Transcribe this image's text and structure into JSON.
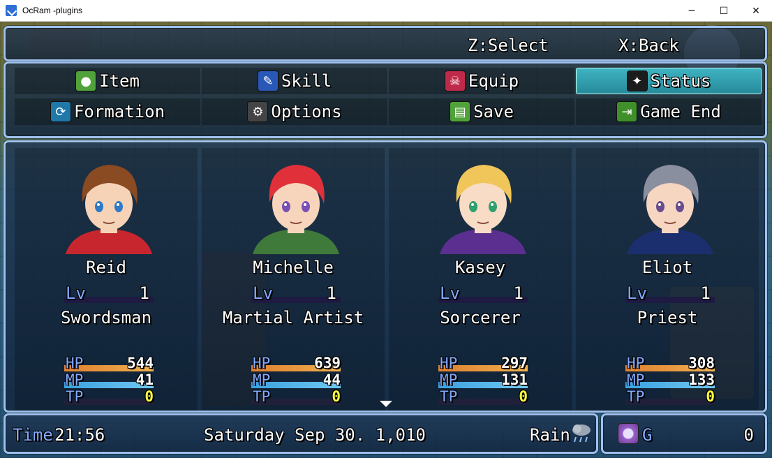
{
  "window": {
    "title": "OcRam -plugins",
    "controls": {
      "minimize": "─",
      "maximize": "☐",
      "close": "✕"
    }
  },
  "help": {
    "select": "Z:Select",
    "back": "X:Back"
  },
  "commands": [
    {
      "label": "Item",
      "icon": "bag-icon",
      "color": "#4fa33a",
      "glyph": "●",
      "selected": false
    },
    {
      "label": "Skill",
      "icon": "wand-icon",
      "color": "#2a58b8",
      "glyph": "✎",
      "selected": false
    },
    {
      "label": "Equip",
      "icon": "skull-icon",
      "color": "#c02a4a",
      "glyph": "☠",
      "selected": false
    },
    {
      "label": "Status",
      "icon": "boot-icon",
      "color": "#1c1c1c",
      "glyph": "✦",
      "selected": true
    },
    {
      "label": "Formation",
      "icon": "refresh-icon",
      "color": "#1f78a8",
      "glyph": "⟳",
      "selected": false
    },
    {
      "label": "Options",
      "icon": "gear-icon",
      "color": "#444444",
      "glyph": "⚙",
      "selected": false
    },
    {
      "label": "Save",
      "icon": "book-icon",
      "color": "#4fa33a",
      "glyph": "▤",
      "selected": false
    },
    {
      "label": "Game End",
      "icon": "exit-door-icon",
      "color": "#3f8f2a",
      "glyph": "⇥",
      "selected": false
    }
  ],
  "party": [
    {
      "name": "Reid",
      "class": "Swordsman",
      "level": "1",
      "hp": "544",
      "mp": "41",
      "tp": "0",
      "hp_ratio": 1,
      "mp_ratio": 1,
      "tp_ratio": 0,
      "portrait": {
        "hair": "#8a4a22",
        "skin": "#f6d3b6",
        "cloth": "#c8262e",
        "eyes": "#2f79c7"
      }
    },
    {
      "name": "Michelle",
      "class": "Martial Artist",
      "level": "1",
      "hp": "639",
      "mp": "44",
      "tp": "0",
      "hp_ratio": 1,
      "mp_ratio": 1,
      "tp_ratio": 0,
      "portrait": {
        "hair": "#e0303a",
        "skin": "#f7d5bd",
        "cloth": "#3f7a3a",
        "eyes": "#7a4fb5"
      }
    },
    {
      "name": "Kasey",
      "class": "Sorcerer",
      "level": "1",
      "hp": "297",
      "mp": "131",
      "tp": "0",
      "hp_ratio": 1,
      "mp_ratio": 1,
      "tp_ratio": 0,
      "portrait": {
        "hair": "#f0c65a",
        "skin": "#f8dcc6",
        "cloth": "#5a2f8f",
        "eyes": "#2fa06e"
      }
    },
    {
      "name": "Eliot",
      "class": "Priest",
      "level": "1",
      "hp": "308",
      "mp": "133",
      "tp": "0",
      "hp_ratio": 1,
      "mp_ratio": 1,
      "tp_ratio": 0,
      "portrait": {
        "hair": "#8a8f9f",
        "skin": "#f6d6c0",
        "cloth": "#1b2f6e",
        "eyes": "#6a4b8f"
      }
    }
  ],
  "labels": {
    "lv": "Lv",
    "hp": "HP",
    "mp": "MP",
    "tp": "TP"
  },
  "colors": {
    "hp_gauge": [
      "#e0802f",
      "#f0b050"
    ],
    "mp_gauge": [
      "#3aa0e0",
      "#70c8f0"
    ],
    "tp_value": "#ffff40",
    "system_text": "#84aaff",
    "window_border": "#9fc2ef"
  },
  "footer": {
    "time_label": "Time",
    "time": "21:56",
    "date": "Saturday Sep 30.  1,010",
    "weather": "Rain",
    "gold_label": "G",
    "gold": "0"
  }
}
